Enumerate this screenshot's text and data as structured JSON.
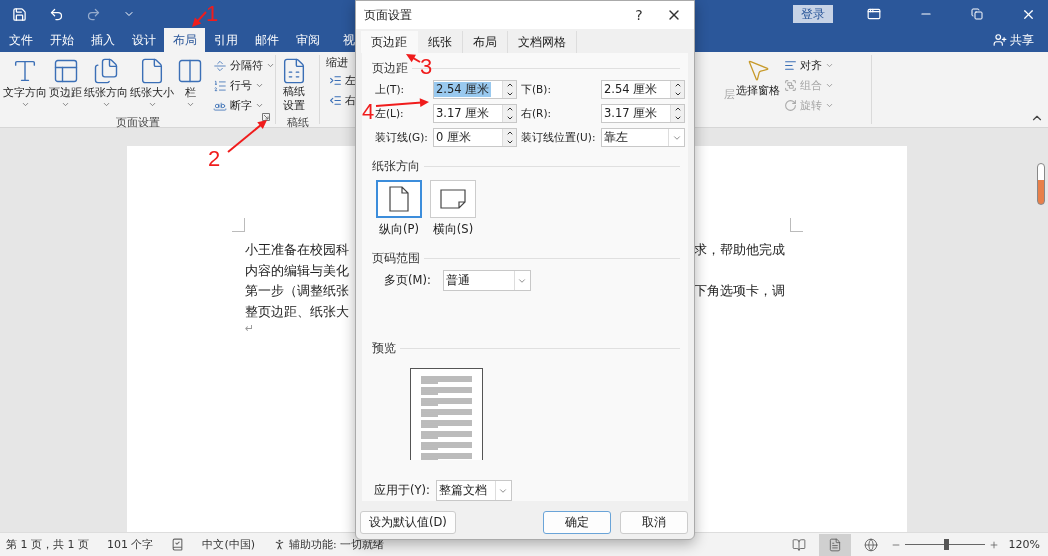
{
  "title_bar": {
    "sign_in": "登录"
  },
  "ribbon_tabs": [
    {
      "label": "文件",
      "selected": false
    },
    {
      "label": "开始",
      "selected": false
    },
    {
      "label": "插入",
      "selected": false
    },
    {
      "label": "设计",
      "selected": false
    },
    {
      "label": "布局",
      "selected": true
    },
    {
      "label": "引用",
      "selected": false
    },
    {
      "label": "邮件",
      "selected": false
    },
    {
      "label": "审阅",
      "selected": false
    },
    {
      "label": "视",
      "selected": false
    }
  ],
  "share": "共享",
  "ribbon": {
    "page_setup": {
      "big_buttons": [
        {
          "label": "文字方向",
          "kind": "text"
        },
        {
          "label": "页边距",
          "kind": "margins"
        },
        {
          "label": "纸张方向",
          "kind": "orientation"
        },
        {
          "label": "纸张大小",
          "kind": "size"
        },
        {
          "label": "栏",
          "kind": "columns"
        }
      ],
      "small_buttons": [
        {
          "label": "分隔符",
          "kind": "breaks"
        },
        {
          "label": "行号",
          "kind": "lines"
        },
        {
          "label": "断字",
          "kind": "hyphen"
        }
      ],
      "label": "页面设置"
    },
    "manuscript": {
      "button": "稿纸设置",
      "label": "稿纸"
    },
    "indent": {
      "label": "缩进",
      "items": [
        "左",
        "右"
      ]
    },
    "arrange": {
      "partial": "层",
      "selection_pane": "选择窗格",
      "items": [
        {
          "label": "对齐",
          "disabled": false
        },
        {
          "label": "组合",
          "disabled": true
        },
        {
          "label": "旋转",
          "disabled": true
        }
      ]
    }
  },
  "document": {
    "lines": [
      {
        "left": "小王准备在校园科",
        "right": "求，帮助他完成"
      },
      {
        "left": "内容的编辑与美化"
      },
      {
        "left": "第一步（调整纸张",
        "right": "下角选项卡，调"
      },
      {
        "left": "整页边距、纸张大"
      }
    ],
    "paragraph_mark": "↵"
  },
  "status_bar": {
    "page": "第 1 页，共 1 页",
    "words": "101 个字",
    "language": "中文(中国)",
    "accessibility": "辅助功能: 一切就绪",
    "views": [
      {
        "kind": "read",
        "selected": false
      },
      {
        "kind": "print",
        "selected": true
      },
      {
        "kind": "web",
        "selected": false
      }
    ],
    "zoom_slider": {
      "level": 0.52
    },
    "zoom": "120%"
  },
  "dialog": {
    "title": "页面设置",
    "help": "?",
    "tabs": [
      {
        "label": "页边距",
        "selected": true
      },
      {
        "label": "纸张",
        "selected": false
      },
      {
        "label": "布局",
        "selected": false
      },
      {
        "label": "文档网格",
        "selected": false
      }
    ],
    "margins": {
      "heading": "页边距",
      "fields": [
        {
          "label": "上(T):",
          "value": "2.54 厘米",
          "kind": "spin",
          "text_selected": true
        },
        {
          "label": "下(B):",
          "value": "2.54 厘米",
          "kind": "spin",
          "text_selected": false
        },
        {
          "label": "左(L):",
          "value": "3.17 厘米",
          "kind": "spin",
          "text_selected": false
        },
        {
          "label": "右(R):",
          "value": "3.17 厘米",
          "kind": "spin",
          "text_selected": false
        },
        {
          "label": "装订线(G):",
          "value": "0 厘米",
          "kind": "spin",
          "text_selected": false
        },
        {
          "label": "装订线位置(U):",
          "value": "靠左",
          "kind": "select",
          "text_selected": false
        }
      ]
    },
    "orientation": {
      "heading": "纸张方向",
      "options": [
        {
          "label": "纵向(P)",
          "kind": "portrait",
          "selected": true
        },
        {
          "label": "横向(S)",
          "kind": "landscape",
          "selected": false
        }
      ]
    },
    "pages": {
      "heading": "页码范围",
      "label": "多页(M):",
      "value": "普通"
    },
    "preview": {
      "heading": "预览"
    },
    "apply": {
      "label": "应用于(Y):",
      "value": "整篇文档"
    },
    "buttons": [
      {
        "label": "设为默认值(D)",
        "kind": "default"
      },
      {
        "label": "确定",
        "kind": "primary"
      },
      {
        "label": "取消",
        "kind": "normal"
      }
    ]
  },
  "annotations": [
    {
      "number": "1"
    },
    {
      "number": "2"
    },
    {
      "number": "3"
    },
    {
      "number": "4"
    }
  ]
}
